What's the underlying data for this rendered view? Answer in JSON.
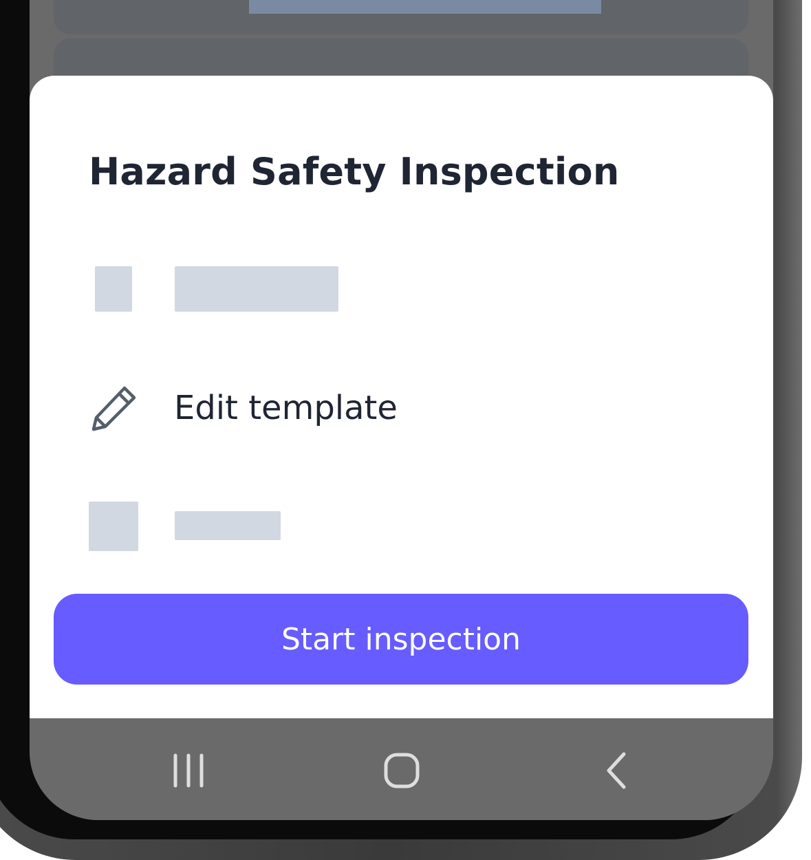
{
  "sheet": {
    "title": "Hazard Safety Inspection",
    "edit_label": "Edit template",
    "start_label": "Start inspection"
  },
  "colors": {
    "accent": "#675cff",
    "placeholder": "#d1d8e2",
    "text": "#1f2533",
    "scrim": "#6a6a6a"
  },
  "icons": {
    "edit": "pencil-icon",
    "nav_recent": "recent-apps-icon",
    "nav_home": "home-icon",
    "nav_back": "back-icon"
  }
}
